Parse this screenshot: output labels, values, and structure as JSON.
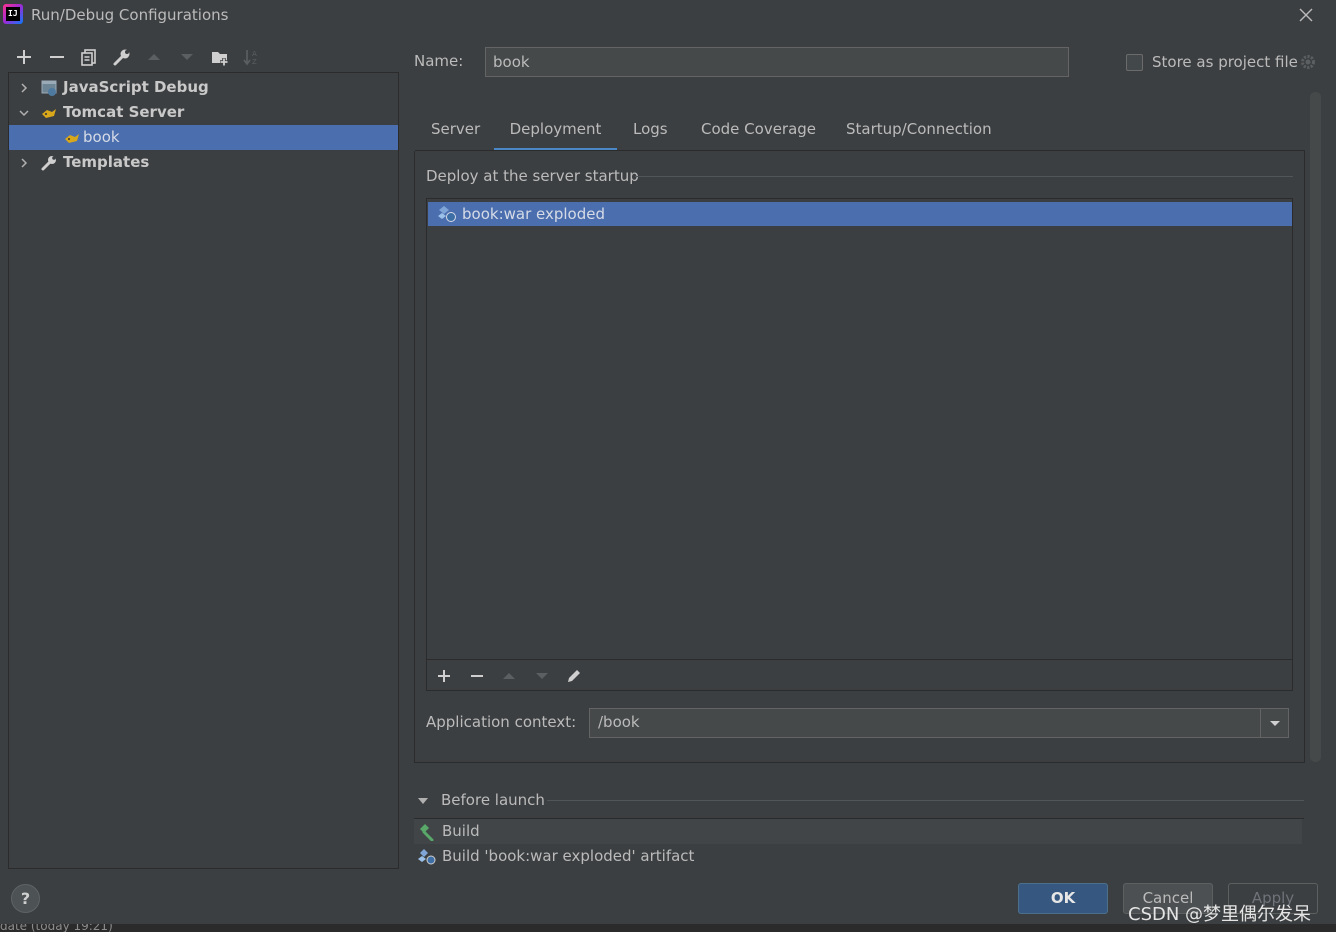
{
  "window": {
    "title": "Run/Debug Configurations",
    "logo_text": "IJ"
  },
  "left_toolbar": {
    "icons": [
      "add-icon",
      "remove-icon",
      "copy-icon",
      "wrench-icon",
      "move-up-icon",
      "move-down-icon",
      "new-folder-icon",
      "sort-icon"
    ]
  },
  "tree": {
    "items": [
      {
        "label": "JavaScript Debug",
        "expanded": false,
        "icon": "javascript-debug-icon"
      },
      {
        "label": "Tomcat Server",
        "expanded": true,
        "icon": "tomcat-icon"
      },
      {
        "label": "book",
        "selected": true,
        "icon": "tomcat-icon"
      },
      {
        "label": "Templates",
        "expanded": false,
        "icon": "wrench-icon"
      }
    ]
  },
  "name": {
    "label": "Name:",
    "value": "book"
  },
  "store_as_project_file": {
    "label": "Store as project file",
    "checked": false
  },
  "tabs": [
    {
      "label": "Server",
      "active": false
    },
    {
      "label": "Deployment",
      "active": true
    },
    {
      "label": "Logs",
      "active": false
    },
    {
      "label": "Code Coverage",
      "active": false
    },
    {
      "label": "Startup/Connection",
      "active": false
    }
  ],
  "deployment": {
    "heading": "Deploy at the server startup",
    "artifacts": [
      "book:war exploded"
    ],
    "context_label": "Application context:",
    "context_value": "/book"
  },
  "before_launch": {
    "label": "Before launch",
    "items": [
      {
        "label": "Build",
        "icon": "hammer-icon"
      },
      {
        "label": "Build 'book:war exploded' artifact",
        "icon": "artifact-icon"
      }
    ]
  },
  "buttons": {
    "help": "?",
    "ok": "OK",
    "cancel": "Cancel",
    "apply": "Apply"
  },
  "watermark": "CSDN @梦里偶尔发呆",
  "bottom_strip_text": "date    (today 19:21)",
  "colors": {
    "background": "#3c3f41",
    "selection": "#4b6eaf",
    "accent_tab": "#4a88c7",
    "ok_button": "#365880"
  }
}
